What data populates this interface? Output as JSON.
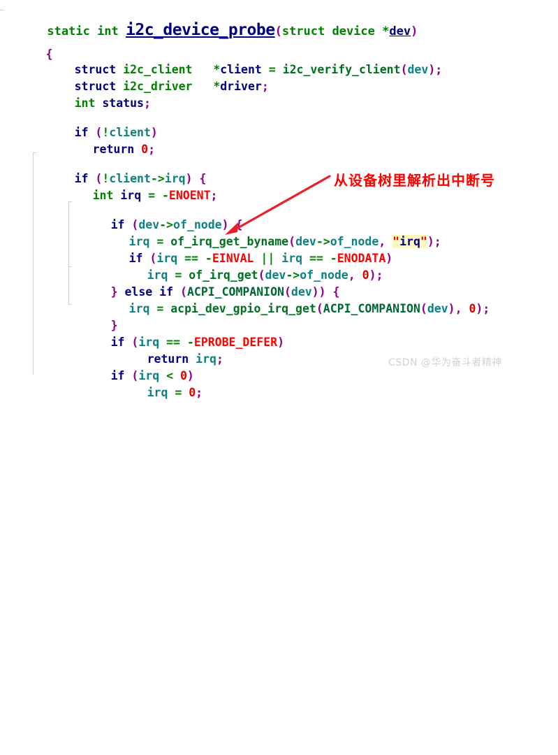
{
  "title": "i2c_device_probe source code snippet",
  "code": {
    "language": "C",
    "lines": [
      {
        "indent": 0,
        "text": "static int i2c_device_probe(struct device *dev)"
      },
      {
        "indent": 0,
        "text": "{"
      },
      {
        "indent": 1,
        "text": "struct i2c_client   *client = i2c_verify_client(dev);"
      },
      {
        "indent": 1,
        "text": "struct i2c_driver   *driver;"
      },
      {
        "indent": 1,
        "text": "int status;"
      },
      {
        "indent": 0,
        "text": ""
      },
      {
        "indent": 1,
        "text": "if (!client)"
      },
      {
        "indent": 2,
        "text": "return 0;"
      },
      {
        "indent": 0,
        "text": ""
      },
      {
        "indent": 1,
        "text": "if (!client->irq) {"
      },
      {
        "indent": 2,
        "text": "int irq = -ENOENT;"
      },
      {
        "indent": 0,
        "text": ""
      },
      {
        "indent": 2,
        "text": "if (dev->of_node) {"
      },
      {
        "indent": 3,
        "text": "irq = of_irq_get_byname(dev->of_node, \"irq\");"
      },
      {
        "indent": 3,
        "text": "if (irq == -EINVAL || irq == -ENODATA)"
      },
      {
        "indent": 4,
        "text": "irq = of_irq_get(dev->of_node, 0);"
      },
      {
        "indent": 2,
        "text": "} else if (ACPI_COMPANION(dev)) {"
      },
      {
        "indent": 3,
        "text": "irq = acpi_dev_gpio_irq_get(ACPI_COMPANION(dev), 0);"
      },
      {
        "indent": 2,
        "text": "}"
      },
      {
        "indent": 2,
        "text": "if (irq == -EPROBE_DEFER)"
      },
      {
        "indent": 3,
        "text": "return irq;"
      },
      {
        "indent": 2,
        "text": "if (irq < 0)"
      },
      {
        "indent": 3,
        "text": "irq = 0;"
      }
    ],
    "highlighted_string": "\"irq\"",
    "colors": {
      "keyword_type": "#008000",
      "keyword_control": "#00007f",
      "function_name": "#007020",
      "identifier": "#0e8080",
      "punctuation": "#8b008b",
      "number": "#e00000",
      "errno": "#ff0000",
      "string_highlight_bg": "#fdf8c0",
      "background": "#ffffff",
      "guide": "#cfcfcf"
    }
  },
  "annotation": {
    "text": "从设备树里解析出中断号",
    "color": "#ff0000",
    "arrow_color": "#e8202a"
  },
  "watermark": {
    "text": "CSDN @华为奋斗者精神",
    "color": "#d2d2d2"
  }
}
